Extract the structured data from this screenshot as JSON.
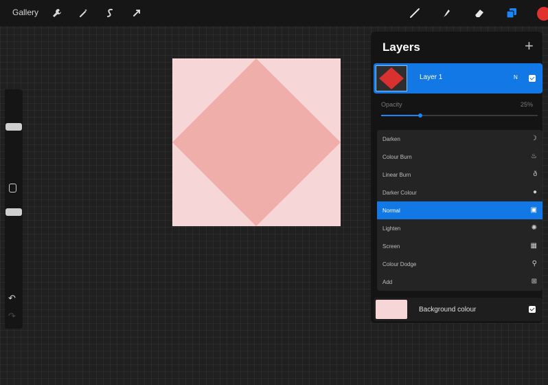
{
  "toolbar": {
    "gallery_label": "Gallery",
    "left_icons": [
      "wrench-icon",
      "magic-wand-icon",
      "selection-icon",
      "transform-icon"
    ],
    "right_icons": [
      "brush-icon",
      "smudge-icon",
      "eraser-icon",
      "layers-icon"
    ],
    "active_color": "#e0332f"
  },
  "canvas": {
    "background_color": "#f6d6d6",
    "shape_color": "#f0aeab",
    "shape": "diamond"
  },
  "layers_panel": {
    "title": "Layers",
    "add_label": "+",
    "layer": {
      "name": "Layer 1",
      "mode_abbrev": "N",
      "visible": true,
      "thumbnail_color": "#d93030"
    },
    "opacity": {
      "label": "Opacity",
      "value_text": "25%",
      "value": 0.25
    },
    "blend_modes": [
      {
        "label": "Darken",
        "icon": "moon-icon",
        "glyph": "☽",
        "selected": false
      },
      {
        "label": "Colour Burn",
        "icon": "flame-icon",
        "glyph": "♨",
        "selected": false
      },
      {
        "label": "Linear Burn",
        "icon": "fire-icon",
        "glyph": "ð",
        "selected": false
      },
      {
        "label": "Darker Colour",
        "icon": "circle-dot-icon",
        "glyph": "●",
        "selected": false
      },
      {
        "label": "Normal",
        "icon": "normal-square-icon",
        "glyph": "▣",
        "selected": true
      },
      {
        "label": "Lighten",
        "icon": "sun-icon",
        "glyph": "✺",
        "selected": false
      },
      {
        "label": "Screen",
        "icon": "screen-grid-icon",
        "glyph": "▦",
        "selected": false
      },
      {
        "label": "Colour Dodge",
        "icon": "dodge-icon",
        "glyph": "⚲",
        "selected": false
      },
      {
        "label": "Add",
        "icon": "add-square-icon",
        "glyph": "⊞",
        "selected": false
      }
    ],
    "background": {
      "label": "Background colour",
      "color": "#f6d6d6",
      "visible": true
    }
  }
}
